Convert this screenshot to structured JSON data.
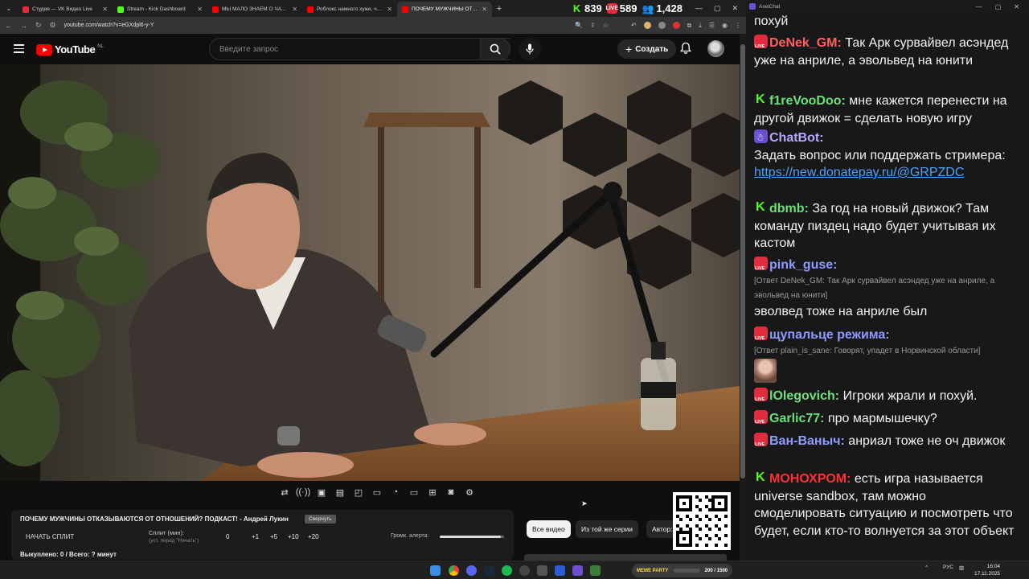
{
  "browser": {
    "tabs": [
      {
        "label": "Студия — VK Видео Live",
        "color": "#e22b3c"
      },
      {
        "label": "Stream - Kick Dashboard",
        "color": "#53fc18"
      },
      {
        "label": "МЫ МАЛО ЗНАЕМ О ЧАТРУЛ",
        "color": "#ff0000"
      },
      {
        "label": "Роблокс намного хуже, чем я",
        "color": "#ff0000"
      },
      {
        "label": "ПОЧЕМУ МУЖЧИНЫ ОТКАЗЫ",
        "color": "#ff0000"
      }
    ],
    "active_tab": 4,
    "url": "youtube.com/watch?v=eGXdpl6-y-Y",
    "counters": [
      {
        "platform": "kick",
        "value": "839",
        "color": "#53fc18"
      },
      {
        "platform": "vk",
        "value": "589",
        "color": "#e22b3c"
      },
      {
        "platform": "viewers",
        "value": "1,428",
        "color": "#ffffff"
      }
    ]
  },
  "youtube": {
    "logo_word": "YouTube",
    "region": "NL",
    "search_placeholder": "Введите запрос",
    "create_label": "Создать",
    "chips": [
      "Все видео",
      "Из той же серии",
      "Автор:"
    ]
  },
  "split_panel": {
    "title": "ПОЧЕМУ МУЖЧИНЫ ОТКАЗЫВАЮТСЯ ОТ ОТНОШЕНИЙ? ПОДКАСТ! - Андрей Лукин",
    "minimize_label": "Свернуть",
    "start_label": "НАЧАТЬ СПЛИТ",
    "split_label": "Сплит (мин):",
    "split_hint": "(уст. перед \"Начать\")",
    "values": [
      "0",
      "+1",
      "+5",
      "+10",
      "+20"
    ],
    "alert_label": "Громк. алерта:",
    "alert_volume": 0.95,
    "sold_label": "Выкуплено: 0 / Всего: ? минут"
  },
  "chat": {
    "window_title": "AxelChat",
    "messages": [
      {
        "platform": "",
        "nick": "",
        "color": "",
        "text": "похуй",
        "reply": ""
      },
      {
        "platform": "vk",
        "nick": "DeNek_GM:",
        "color": "#ff5f5f",
        "text": "Так Арк сурвайвел асэндед уже на анриле, а эвольвед на юнити",
        "reply": ""
      },
      {
        "platform": "kick",
        "nick": "f1reVooDoo:",
        "color": "#6ee07a",
        "text": "мне кажется перенести на другой движок = сделать новую игру",
        "reply": ""
      },
      {
        "platform": "bot",
        "nick": "ChatBot:",
        "color": "#b9a6ff",
        "text": "Задать вопрос или поддержать стримера:",
        "link": "https://new.donatepay.ru/@GRPZDC",
        "reply": ""
      },
      {
        "platform": "kick",
        "nick": "dbmb:",
        "color": "#6ee07a",
        "text": "За год на новый движок? Там команду пиздец надо будет учитывая их кастом",
        "reply": ""
      },
      {
        "platform": "vk",
        "nick": "pink_guse:",
        "color": "#8f9bff",
        "text": "эволвед тоже на анриле был",
        "reply": "[Ответ DeNek_GM: Так Арк сурвайвел асэндед уже на анриле, а эвольвед на юнити]"
      },
      {
        "platform": "vk",
        "nick": "щупальце режима:",
        "color": "#8f9bff",
        "text": "",
        "reply": "[Ответ plain_is_sane: Говорят, упадет в Норвинской области]",
        "emote": "face-emote"
      },
      {
        "platform": "vk",
        "nick": "lOlegovich:",
        "color": "#6ee07a",
        "text": "Игроки жрали и похуй.",
        "reply": ""
      },
      {
        "platform": "vk",
        "nick": "Garlic77:",
        "color": "#6ee07a",
        "text": "про мармышечку?",
        "reply": ""
      },
      {
        "platform": "vk",
        "nick": "Ван-Ваныч:",
        "color": "#8f9bff",
        "text": "анриал тоже не оч движок",
        "reply": ""
      },
      {
        "platform": "kick",
        "nick": "МОНОХРОМ:",
        "color": "#ff3030",
        "text": "есть игра называется universe sandbox, там можно смоделировать ситуацию и посмотреть что будет, если кто-то волнуется за этот объект",
        "reply": ""
      }
    ]
  },
  "taskbar": {
    "meme_label": "MEME PARTY",
    "meme_progress": "200 / 1500",
    "lang": "РУС",
    "time": "16:04",
    "date": "17.11.2025"
  }
}
